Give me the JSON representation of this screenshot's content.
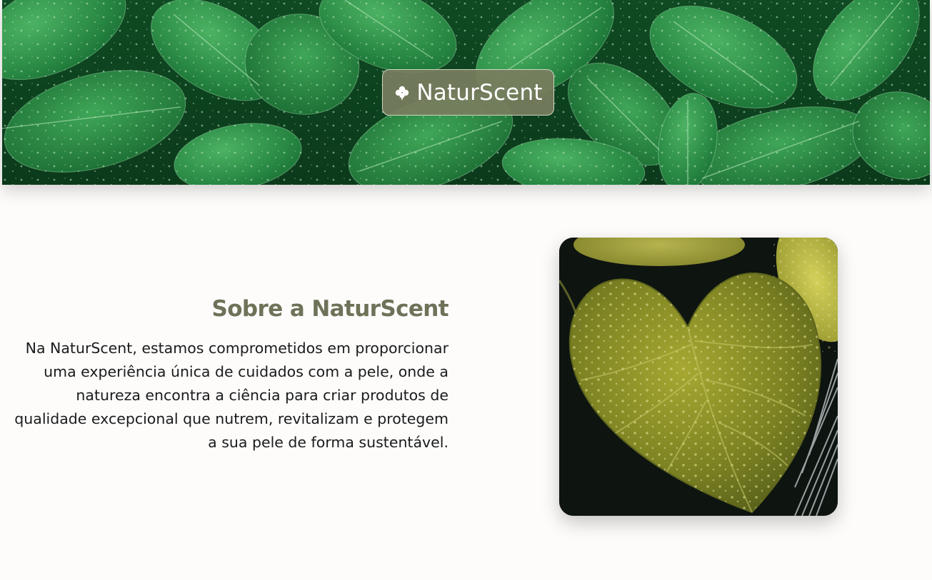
{
  "brand": {
    "icon": "clover-icon",
    "name": "NaturScent"
  },
  "hero": {
    "image": "green-leaves-with-water-drops"
  },
  "about": {
    "title": "Sobre a NaturScent",
    "body": "Na NaturScent, estamos comprometidos em proporcionar uma experiência única de cuidados com a pele, onde a natureza encontra a ciência para criar produtos de qualidade excepcional que nutrem, revitalizam e protegem a sua pele de forma sustentável.",
    "image": "yellow-green-leaf-with-water-drops"
  },
  "colors": {
    "page_background": "#fdfcfb",
    "title_olive": "#6e7258",
    "badge_olive": "#787d5f",
    "text": "#1b1b1b"
  }
}
